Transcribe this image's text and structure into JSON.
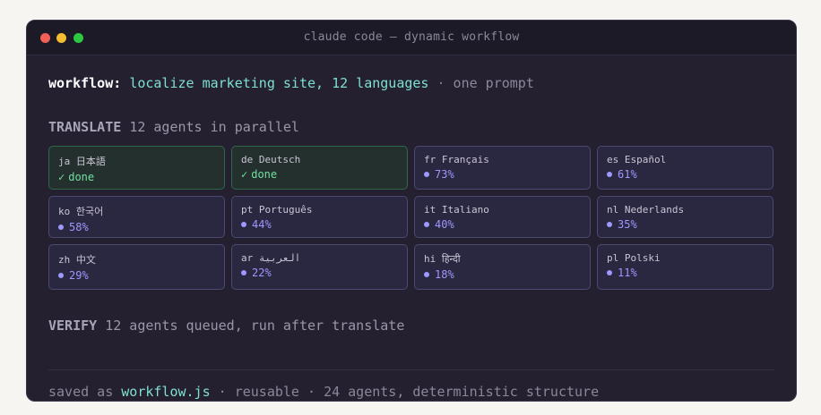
{
  "window": {
    "title": "claude code — dynamic workflow"
  },
  "workflow": {
    "key": "workflow:",
    "task": "localize marketing site, 12 languages",
    "separator": "·",
    "note": "one prompt"
  },
  "translate": {
    "title": "TRANSLATE",
    "description": "12 agents in parallel",
    "agents": [
      {
        "lang": "ja 日本語",
        "status": "done",
        "state": "done"
      },
      {
        "lang": "de Deutsch",
        "status": "done",
        "state": "done"
      },
      {
        "lang": "fr Français",
        "status": "73%",
        "state": "progress"
      },
      {
        "lang": "es Español",
        "status": "61%",
        "state": "progress"
      },
      {
        "lang": "ko 한국어",
        "status": "58%",
        "state": "progress"
      },
      {
        "lang": "pt Português",
        "status": "44%",
        "state": "progress"
      },
      {
        "lang": "it Italiano",
        "status": "40%",
        "state": "progress"
      },
      {
        "lang": "nl Nederlands",
        "status": "35%",
        "state": "progress"
      },
      {
        "lang": "zh 中文",
        "status": "29%",
        "state": "progress"
      },
      {
        "lang": "ar العربية",
        "status": "22%",
        "state": "progress"
      },
      {
        "lang": "hi हिन्दी",
        "status": "18%",
        "state": "progress"
      },
      {
        "lang": "pl Polski",
        "status": "11%",
        "state": "progress"
      }
    ]
  },
  "verify": {
    "title": "VERIFY",
    "description": "12 agents queued, run after translate"
  },
  "footer": {
    "prefix": "saved as",
    "filename": "workflow.js",
    "sep1": "·",
    "reusable": "reusable",
    "sep2": "·",
    "summary": "24 agents, deterministic structure"
  },
  "colors": {
    "accent_teal": "#7ee0d0",
    "done_green": "#72e0a1",
    "progress_purple": "#9e98ff",
    "window_bg": "#242030"
  }
}
